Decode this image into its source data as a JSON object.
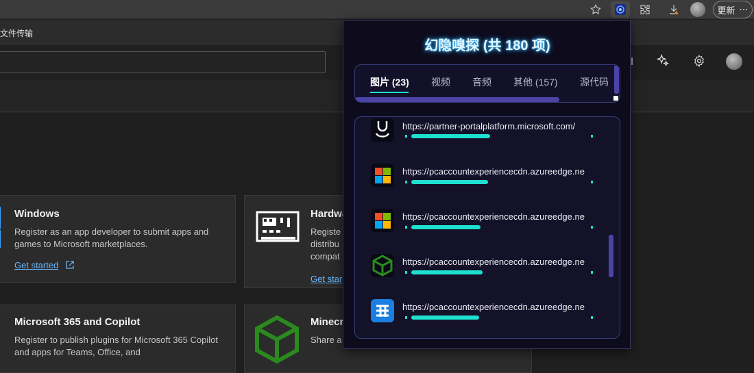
{
  "browser": {
    "update_label": "更新",
    "more_label": "⋯"
  },
  "favorites": {
    "item_label": "文件传输"
  },
  "cards": [
    {
      "title": "Windows",
      "description": "Register as an app developer to submit apps and games to Microsoft marketplaces.",
      "link": "Get started"
    },
    {
      "title": "Hardwa",
      "description": "Registe distribu compat",
      "link": "Get star"
    },
    {
      "title": "Microsoft 365 and Copilot",
      "description": "Register to publish plugins for Microsoft 365 Copilot and apps for Teams, Office, and",
      "link": ""
    },
    {
      "title": "Minecr",
      "description": "Share a Minecraft in-game Marketplace.",
      "link": ""
    }
  ],
  "popup": {
    "title": "幻隐嗅探 (共 180 项)",
    "tabs": [
      {
        "label": "图片 (23)"
      },
      {
        "label": "视频"
      },
      {
        "label": "音频"
      },
      {
        "label": "其他 (157)"
      },
      {
        "label": "源代码"
      }
    ],
    "items": [
      {
        "url": "https://partner-portalplatform.microsoft.com/",
        "icon": "partner-logo",
        "progress": 0.42
      },
      {
        "url": "https://pcaccountexperiencecdn.azureedge.ne",
        "icon": "microsoft-logo",
        "progress": 0.41
      },
      {
        "url": "https://pcaccountexperiencecdn.azureedge.ne",
        "icon": "microsoft-logo",
        "progress": 0.37
      },
      {
        "url": "https://pcaccountexperiencecdn.azureedge.ne",
        "icon": "minecraft-logo",
        "progress": 0.38
      },
      {
        "url": "https://pcaccountexperiencecdn.azureedge.ne",
        "icon": "blue-grid-logo",
        "progress": 0.36
      }
    ]
  },
  "colors": {
    "accent_teal": "#1de0d0",
    "popup_bg": "#0d0b1c",
    "link_blue": "#6cb8ff",
    "ms_red": "#f25022",
    "ms_green": "#7fba00",
    "ms_blue": "#00a4ef",
    "ms_yellow": "#ffb900"
  }
}
